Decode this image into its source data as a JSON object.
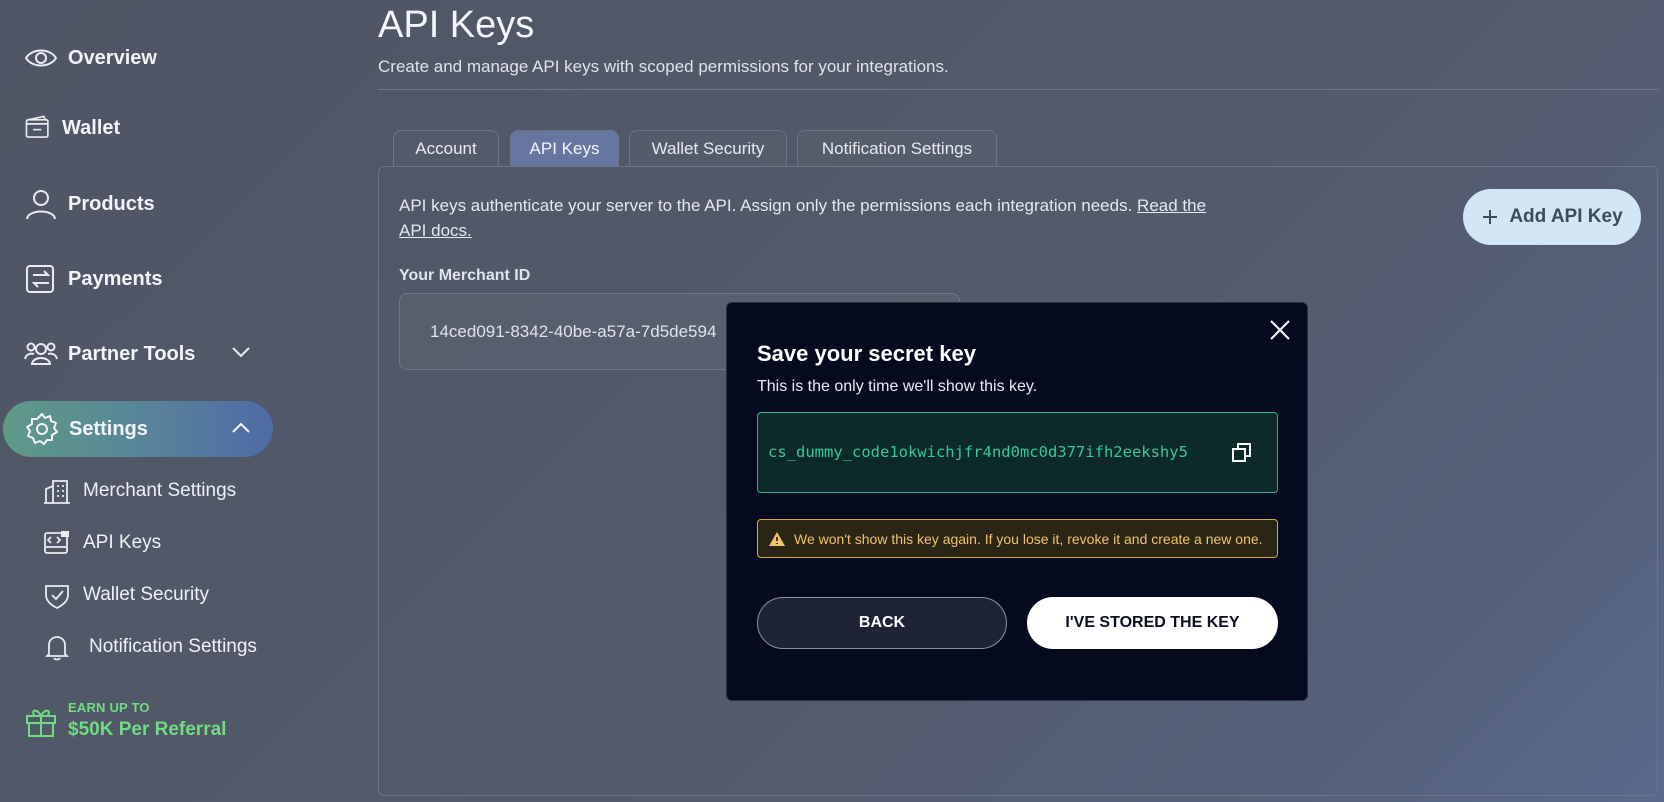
{
  "sidebar": {
    "items": [
      {
        "label": "Overview",
        "icon": "eye-icon"
      },
      {
        "label": "Wallet",
        "icon": "wallet-icon"
      },
      {
        "label": "Products",
        "icon": "user-icon"
      },
      {
        "label": "Payments",
        "icon": "transfer-icon"
      },
      {
        "label": "Partner Tools",
        "icon": "users-icon"
      },
      {
        "label": "Settings",
        "icon": "gear-icon"
      }
    ],
    "subitems": [
      {
        "label": "Merchant Settings",
        "icon": "building-icon"
      },
      {
        "label": "API Keys",
        "icon": "key-card-icon"
      },
      {
        "label": "Wallet Security",
        "icon": "shield-check-icon"
      },
      {
        "label": "Notification Settings",
        "icon": "bell-icon"
      }
    ],
    "promo": {
      "line1": "EARN UP TO",
      "line2": "$50K Per Referral",
      "icon": "gift-icon",
      "color": "#6fdc83"
    }
  },
  "header": {
    "title": "API Keys",
    "subtitle": "Create and manage API keys with scoped permissions for your integrations."
  },
  "tabs": [
    {
      "label": "Account",
      "active": false
    },
    {
      "label": "API Keys",
      "active": true
    },
    {
      "label": "Wallet Security",
      "active": false
    },
    {
      "label": "Notification Settings",
      "active": false
    }
  ],
  "panel": {
    "intro": "API keys authenticate your server to the API. Assign only the permissions each integration needs.",
    "docs_link_1": "Read the",
    "docs_link_2": "API docs.",
    "add_button": "Add API Key",
    "merchant_label": "Your Merchant ID",
    "merchant_id": "14ced091-8342-40be-a57a-7d5de594"
  },
  "modal": {
    "title": "Save your secret key",
    "subtitle": "This is the only time we'll show this key.",
    "secret_key": "cs_dummy_code1okwichjfr4nd0mc0d377ifh2eekshy5",
    "warning": "We won't show this key again. If you lose it, revoke it and create a new one.",
    "back_label": "BACK",
    "stored_label": "I'VE STORED THE KEY"
  },
  "colors": {
    "accent": "#6676a0",
    "key_text": "#35c79c",
    "warning": "#f0c56a",
    "promo": "#6fdc83"
  }
}
